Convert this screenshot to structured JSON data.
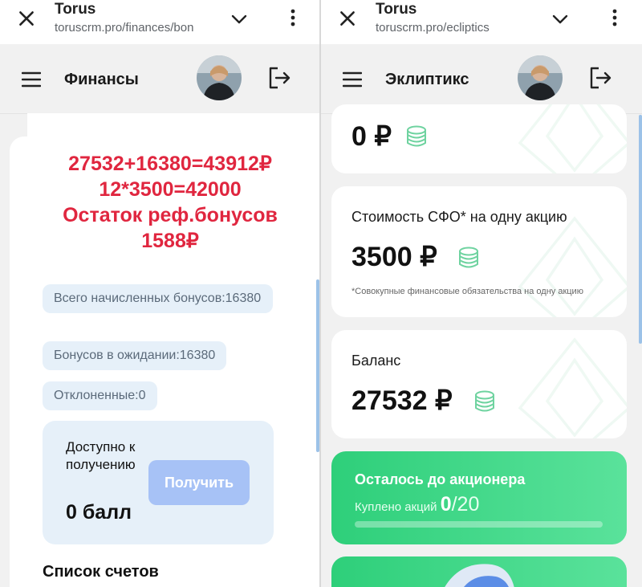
{
  "left": {
    "browser": {
      "title": "Torus",
      "url": "toruscrm.pro/finances/bon"
    },
    "app": {
      "title": "Финансы"
    },
    "overlay_lines": [
      "27532+16380=43912₽",
      "12*3500=42000",
      "Остаток реф.бонусов",
      "1588₽"
    ],
    "chips": {
      "total_accrued": "Всего начисленных бонусов:16380",
      "pending": "Бонусов в ожидании:16380",
      "rejected": "Отклоненные:0"
    },
    "available": {
      "label": "Доступно к получению",
      "value": "0 балл",
      "button": "Получить"
    },
    "accounts_title": "Список счетов"
  },
  "right": {
    "browser": {
      "title": "Torus",
      "url": "toruscrm.pro/ecliptics"
    },
    "app": {
      "title": "Эклиптикс"
    },
    "top_card": {
      "value": "0 ₽"
    },
    "sfo_card": {
      "label": "Стоимость СФО* на одну акцию",
      "value": "3500 ₽",
      "note": "*Совокупные финансовые обязательства на одну акцию"
    },
    "balance_card": {
      "label": "Баланс",
      "value": "27532 ₽"
    },
    "shareholder": {
      "title": "Осталось до акционера",
      "bought_label": "Куплено акций",
      "bought": "0",
      "total": "/20",
      "progress_fraction": 0
    }
  },
  "icons": {
    "close": "close-icon",
    "chevron": "chevron-down-icon",
    "menu": "more-vert-icon",
    "hamburger": "hamburger-icon",
    "logout": "logout-icon",
    "coin": "coins-icon"
  },
  "colors": {
    "accent_red": "#e0263f",
    "chip_bg": "#e6f0f9",
    "button": "#a7c2f6",
    "green": "#2ecf7a",
    "coin": "#6fd3a0"
  }
}
